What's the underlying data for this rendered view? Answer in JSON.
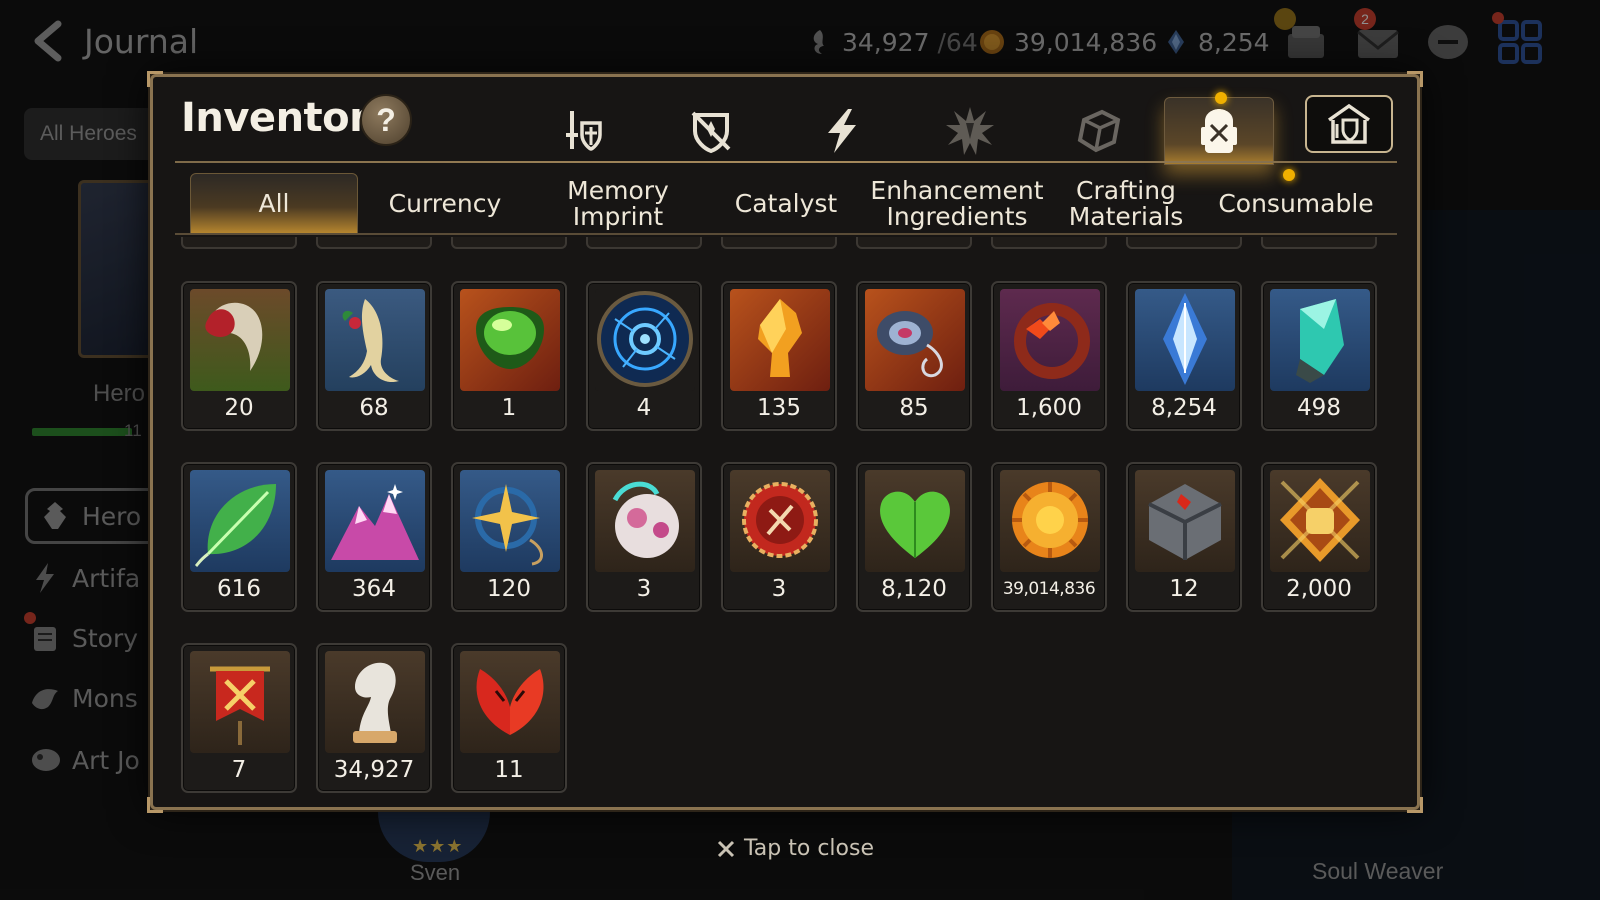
{
  "background": {
    "title": "Journal",
    "resources": [
      {
        "icon": "stamina-icon",
        "value": "34,927",
        "max": "/64"
      },
      {
        "icon": "gold-coin-icon",
        "value": "39,014,836"
      },
      {
        "icon": "skystone-icon",
        "value": "8,254"
      }
    ],
    "mail_badge": "2",
    "filter_button": "All Heroes",
    "hero_caption": "Hero",
    "hero_bar_value": "11",
    "sidebar": [
      {
        "label": "Hero",
        "icon": "hero-icon"
      },
      {
        "label": "Artifa",
        "icon": "artifact-icon"
      },
      {
        "label": "Story",
        "icon": "story-icon"
      },
      {
        "label": "Mons",
        "icon": "monster-icon"
      },
      {
        "label": "Art Jo",
        "icon": "art-icon"
      }
    ],
    "bottom_hero_name": "Sven",
    "bottom_hero_stars": "★★★",
    "right_panel_label": "Soul Weaver"
  },
  "modal": {
    "title": "Inventory",
    "help_label": "?",
    "category_tabs": [
      {
        "name": "equipment-tab",
        "icon": "sword-shield-icon"
      },
      {
        "name": "artifact-tab",
        "icon": "crossed-shield-icon"
      },
      {
        "name": "catalyst-tab",
        "icon": "lightning-icon"
      },
      {
        "name": "enhancement-tab",
        "icon": "burst-icon"
      },
      {
        "name": "materials-tab",
        "icon": "cube-icon"
      },
      {
        "name": "items-tab",
        "icon": "backpack-icon",
        "active": true
      },
      {
        "name": "storage-tab",
        "icon": "house-shield-icon"
      }
    ],
    "sub_tabs": [
      {
        "label": "All",
        "active": true
      },
      {
        "label": "Currency"
      },
      {
        "label": "Memory\nImprint"
      },
      {
        "label": "Catalyst"
      },
      {
        "label": "Enhancement\nIngredients"
      },
      {
        "label": "Crafting\nMaterials"
      },
      {
        "label": "Consumable"
      }
    ],
    "items": [
      {
        "icon": "claw-icon",
        "qty": "20"
      },
      {
        "icon": "ginseng-root-icon",
        "qty": "68"
      },
      {
        "icon": "green-gem-icon",
        "qty": "1"
      },
      {
        "icon": "blue-rune-orb-icon",
        "qty": "4"
      },
      {
        "icon": "amber-crystal-icon",
        "qty": "135"
      },
      {
        "icon": "pendant-icon",
        "qty": "85"
      },
      {
        "icon": "red-ring-icon",
        "qty": "1,600"
      },
      {
        "icon": "skystone-crystal-icon",
        "qty": "8,254"
      },
      {
        "icon": "teal-crystal-icon",
        "qty": "498"
      },
      {
        "icon": "leaf-icon",
        "qty": "616"
      },
      {
        "icon": "pink-mountain-icon",
        "qty": "364"
      },
      {
        "icon": "star-compass-icon",
        "qty": "120"
      },
      {
        "icon": "pet-bubble-icon",
        "qty": "3"
      },
      {
        "icon": "red-medal-icon",
        "qty": "3"
      },
      {
        "icon": "green-heart-icon",
        "qty": "8,120"
      },
      {
        "icon": "sun-coin-icon",
        "qty": "39,014,836"
      },
      {
        "icon": "stone-cube-icon",
        "qty": "12"
      },
      {
        "icon": "fist-emblem-icon",
        "qty": "2,000"
      },
      {
        "icon": "war-banner-icon",
        "qty": "7"
      },
      {
        "icon": "chess-knight-icon",
        "qty": "34,927"
      },
      {
        "icon": "red-petal-icon",
        "qty": "11"
      }
    ],
    "close_hint": "Tap to close"
  },
  "colors": {
    "frame_gold": "#8a7350",
    "active_tab_glow": "#b9882f",
    "notice_dot": "#f0b000",
    "badge_red": "#b53a2a"
  }
}
